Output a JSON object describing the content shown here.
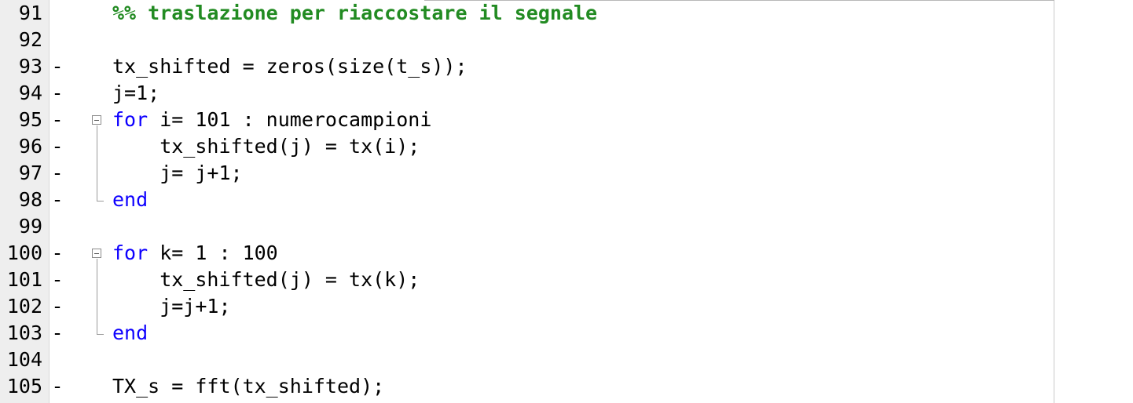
{
  "editor": {
    "lines": [
      {
        "num": "91",
        "marker": "",
        "code": "%% traslazione per riaccostare il segnale"
      },
      {
        "num": "92",
        "marker": "",
        "code": ""
      },
      {
        "num": "93",
        "marker": "-",
        "code": "tx_shifted = zeros(size(t_s));"
      },
      {
        "num": "94",
        "marker": "-",
        "code": "j=1;"
      },
      {
        "num": "95",
        "marker": "-",
        "code": "for",
        "rest": " i= 101 : numerocampioni"
      },
      {
        "num": "96",
        "marker": "-",
        "code": "    tx_shifted(j) = tx(i);"
      },
      {
        "num": "97",
        "marker": "-",
        "code": "    j= j+1;"
      },
      {
        "num": "98",
        "marker": "-",
        "code": "end"
      },
      {
        "num": "99",
        "marker": "",
        "code": ""
      },
      {
        "num": "100",
        "marker": "-",
        "code": "for",
        "rest": " k= 1 : 100"
      },
      {
        "num": "101",
        "marker": "-",
        "code": "    tx_shifted(j) = tx(k);"
      },
      {
        "num": "102",
        "marker": "-",
        "code": "    j=j+1;"
      },
      {
        "num": "103",
        "marker": "-",
        "code": "end"
      },
      {
        "num": "104",
        "marker": "",
        "code": ""
      },
      {
        "num": "105",
        "marker": "-",
        "code": "TX_s = fft(tx_shifted);"
      }
    ]
  },
  "colors": {
    "keyword": "#0e00ff",
    "comment": "#228b22",
    "gutter": "#eeeeee"
  }
}
